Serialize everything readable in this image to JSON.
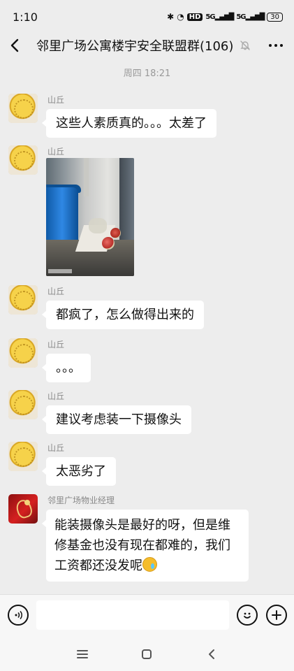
{
  "status_bar": {
    "time": "1:10",
    "battery": "30",
    "network": "5G",
    "hd": "HD"
  },
  "header": {
    "title": "邻里广场公寓楼宇安全联盟群(106)"
  },
  "chat": {
    "timestamp": "周四 18:21",
    "messages": [
      {
        "sender": "山丘",
        "text": "这些人素质真的。。。太差了"
      },
      {
        "sender": "山丘",
        "text": ""
      },
      {
        "sender": "山丘",
        "text": "都疯了，怎么做得出来的"
      },
      {
        "sender": "山丘",
        "text": "。。。"
      },
      {
        "sender": "山丘",
        "text": "建议考虑装一下摄像头"
      },
      {
        "sender": "山丘",
        "text": "太恶劣了"
      },
      {
        "sender": "邻里广场物业经理",
        "text": "能装摄像头是最好的呀，但是维修基金也没有现在都难的，我们工资都还没发呢"
      }
    ]
  },
  "input": {
    "placeholder": ""
  },
  "colors": {
    "background": "#ededed",
    "bubble": "#ffffff",
    "text": "#111111",
    "muted": "#999999"
  },
  "icons": {
    "back": "back-icon",
    "mute": "bell-muted-icon",
    "more": "more-icon",
    "voice": "voice-icon",
    "emoji": "emoji-icon",
    "plus": "plus-icon",
    "nav_menu": "menu-icon",
    "nav_home": "home-icon",
    "nav_back": "back-icon"
  }
}
